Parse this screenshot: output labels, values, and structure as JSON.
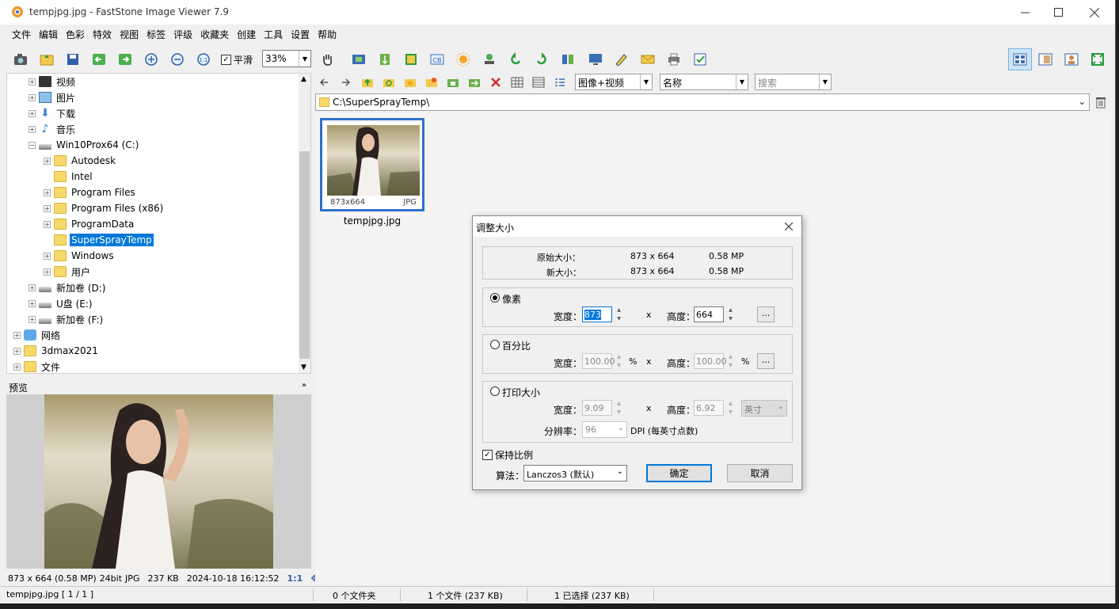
{
  "window": {
    "title": "tempjpg.jpg  -  FastStone Image Viewer 7.9"
  },
  "menu": [
    "文件",
    "编辑",
    "色彩",
    "特效",
    "视图",
    "标签",
    "评级",
    "收藏夹",
    "创建",
    "工具",
    "设置",
    "帮助"
  ],
  "toolbar": {
    "smooth_label": "平滑",
    "zoom_value": "33%"
  },
  "tree": {
    "nodes": [
      {
        "label": "视频",
        "depth": 1,
        "icon": "video-icon"
      },
      {
        "label": "图片",
        "depth": 1,
        "icon": "pictures-icon"
      },
      {
        "label": "下载",
        "depth": 1,
        "icon": "download-icon"
      },
      {
        "label": "音乐",
        "depth": 1,
        "icon": "music-icon"
      },
      {
        "label": "Win10Prox64 (C:)",
        "depth": 1,
        "icon": "drive-icon",
        "expanded": true
      },
      {
        "label": "Autodesk",
        "depth": 2,
        "icon": "folder-icon"
      },
      {
        "label": "Intel",
        "depth": 2,
        "icon": "folder-icon",
        "noexp": true
      },
      {
        "label": "Program Files",
        "depth": 2,
        "icon": "folder-icon"
      },
      {
        "label": "Program Files (x86)",
        "depth": 2,
        "icon": "folder-icon"
      },
      {
        "label": "ProgramData",
        "depth": 2,
        "icon": "folder-icon"
      },
      {
        "label": "SuperSprayTemp",
        "depth": 2,
        "icon": "folder-icon",
        "selected": true,
        "noexp": true
      },
      {
        "label": "Windows",
        "depth": 2,
        "icon": "folder-icon"
      },
      {
        "label": "用户",
        "depth": 2,
        "icon": "folder-icon"
      },
      {
        "label": "新加卷 (D:)",
        "depth": 1,
        "icon": "drive-icon"
      },
      {
        "label": "U盘 (E:)",
        "depth": 1,
        "icon": "drive-icon"
      },
      {
        "label": "新加卷 (F:)",
        "depth": 1,
        "icon": "drive-icon"
      },
      {
        "label": "网络",
        "depth": 0,
        "icon": "network-icon"
      },
      {
        "label": "3dmax2021",
        "depth": 0,
        "icon": "folder-icon"
      },
      {
        "label": "文件",
        "depth": 0,
        "icon": "folder-icon"
      }
    ]
  },
  "preview": {
    "header": "预览",
    "info": {
      "dims": "873 x 664 (0.58 MP)",
      "bits": "24bit",
      "type": "JPG",
      "size": "237 KB",
      "date": "2024-10-18 16:12:52",
      "ratio": "1:1"
    }
  },
  "browser": {
    "filter": "图像+视频",
    "sort": "名称",
    "search_placeholder": "搜索",
    "path": "C:\\SuperSprayTemp\\",
    "thumb": {
      "dims": "873x664",
      "type": "JPG",
      "name": "tempjpg.jpg"
    }
  },
  "statusbar": {
    "file": "tempjpg.jpg [ 1 / 1 ]",
    "folders": "0 个文件夹",
    "files": "1 个文件 (237 KB)",
    "selected": "1 已选择 (237 KB)"
  },
  "dialog": {
    "title": "调整大小",
    "orig_label": "原始大小：",
    "orig_dims": "873 x 664",
    "orig_mp": "0.58 MP",
    "new_label": "新大小：",
    "new_dims": "873 x 664",
    "new_mp": "0.58 MP",
    "pixel": {
      "label": "像素",
      "width_label": "宽度：",
      "width": "873",
      "x": "x",
      "height_label": "高度：",
      "height": "664",
      "dots": "..."
    },
    "percent": {
      "label": "百分比",
      "width_label": "宽度：",
      "width": "100.00",
      "unit": "%",
      "x": "x",
      "height_label": "高度：",
      "height": "100.00",
      "dots": "..."
    },
    "print": {
      "label": "打印大小",
      "width_label": "宽度：",
      "width": "9.09",
      "x": "x",
      "height_label": "高度：",
      "height": "6.92",
      "unit": "英寸",
      "dpi_label": "分辨率：",
      "dpi": "96",
      "dpi_unit": "DPI (每英寸点数)"
    },
    "keep_ratio": "保持比例",
    "algo_label": "算法：",
    "algo": "Lanczos3 (默认)",
    "ok": "确定",
    "cancel": "取消"
  },
  "colors": {
    "accent": "#0078d7",
    "thumb_border": "#2f6fcc",
    "folder": "#f7d86a"
  }
}
